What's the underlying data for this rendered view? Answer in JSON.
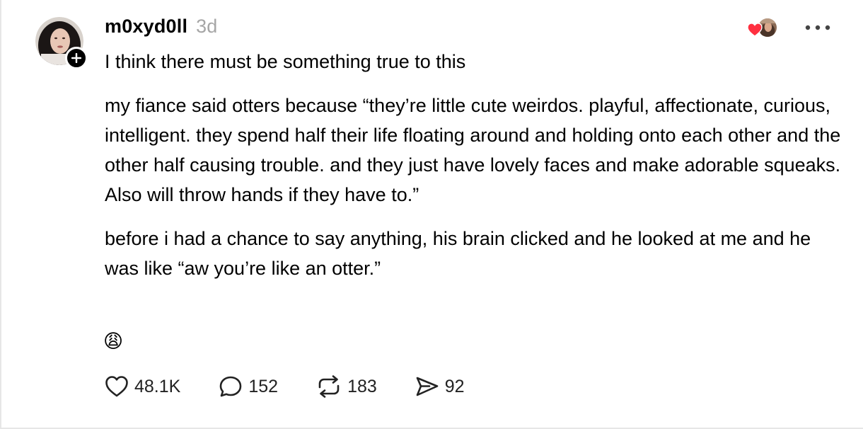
{
  "post": {
    "username": "m0xyd0ll",
    "time": "3d",
    "paragraphs": [
      "I think there must be something true to this",
      "my fiance said otters because “they’re little cute weirdos. playful, affectionate, curious, intelligent. they spend half their life floating around and holding onto each other and the other half causing trouble. and they just have lovely faces and make adorable squeaks. Also will throw hands if they have to.”",
      "before i had a chance to say anything, his brain clicked and he looked at me and he was like “aw you’re like an otter.”"
    ],
    "emoji": "😩"
  },
  "actions": {
    "likes": "48.1K",
    "comments": "152",
    "reposts": "183",
    "shares": "92"
  },
  "icons": {
    "like": "heart-icon",
    "comment": "speech-bubble-icon",
    "repost": "repost-arrows-icon",
    "share": "send-icon",
    "more": "more-dots-icon",
    "follow": "plus-icon"
  },
  "colors": {
    "heart_red": "#ff3040",
    "timestamp_gray": "#a6a6a6",
    "text": "#000000"
  }
}
